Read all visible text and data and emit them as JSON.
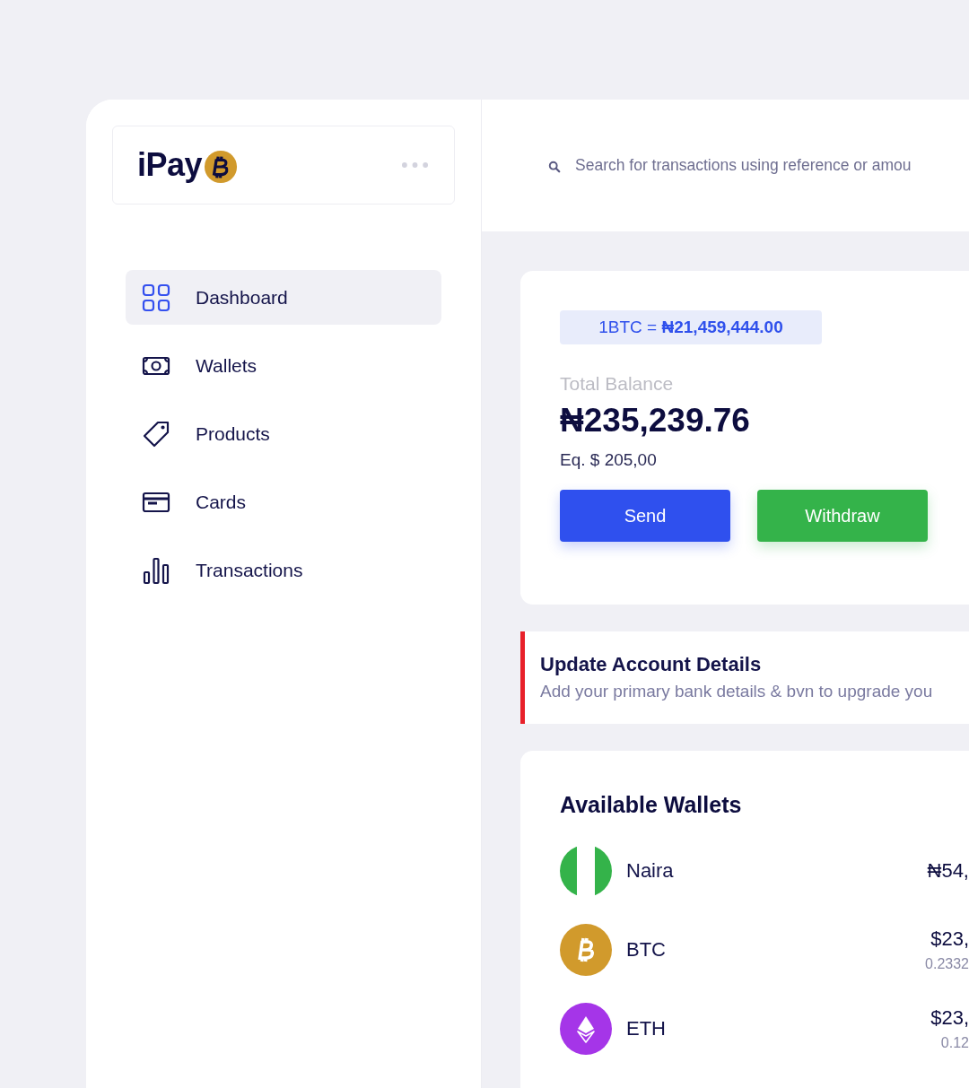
{
  "logo": {
    "text": "iPay"
  },
  "nav": [
    {
      "label": "Dashboard",
      "selected": true
    },
    {
      "label": "Wallets",
      "selected": false
    },
    {
      "label": "Products",
      "selected": false
    },
    {
      "label": "Cards",
      "selected": false
    },
    {
      "label": "Transactions",
      "selected": false
    }
  ],
  "search": {
    "placeholder": "Search for transactions using reference or amou"
  },
  "balance_card": {
    "rate": "1BTC = **₦21,459,444.00**",
    "label": "Total Balance",
    "amount": "₦235,239.76",
    "equivalent": "Eq. $ 205,00",
    "buttons": [
      {
        "label": "Send",
        "kind": "primary"
      },
      {
        "label": "Withdraw",
        "kind": "success"
      }
    ]
  },
  "alert": {
    "title": "Update Account Details",
    "text": "Add your primary bank details & bvn to upgrade you"
  },
  "wallets": {
    "title": "Available Wallets",
    "items": [
      {
        "kind": "naira",
        "name": "Naira",
        "amount": "₦54,"
      },
      {
        "kind": "btc",
        "name": "BTC",
        "amount": "$23,",
        "sub": "0.2332"
      },
      {
        "kind": "eth",
        "name": "ETH",
        "amount": "$23,",
        "sub": "0.12"
      }
    ]
  }
}
